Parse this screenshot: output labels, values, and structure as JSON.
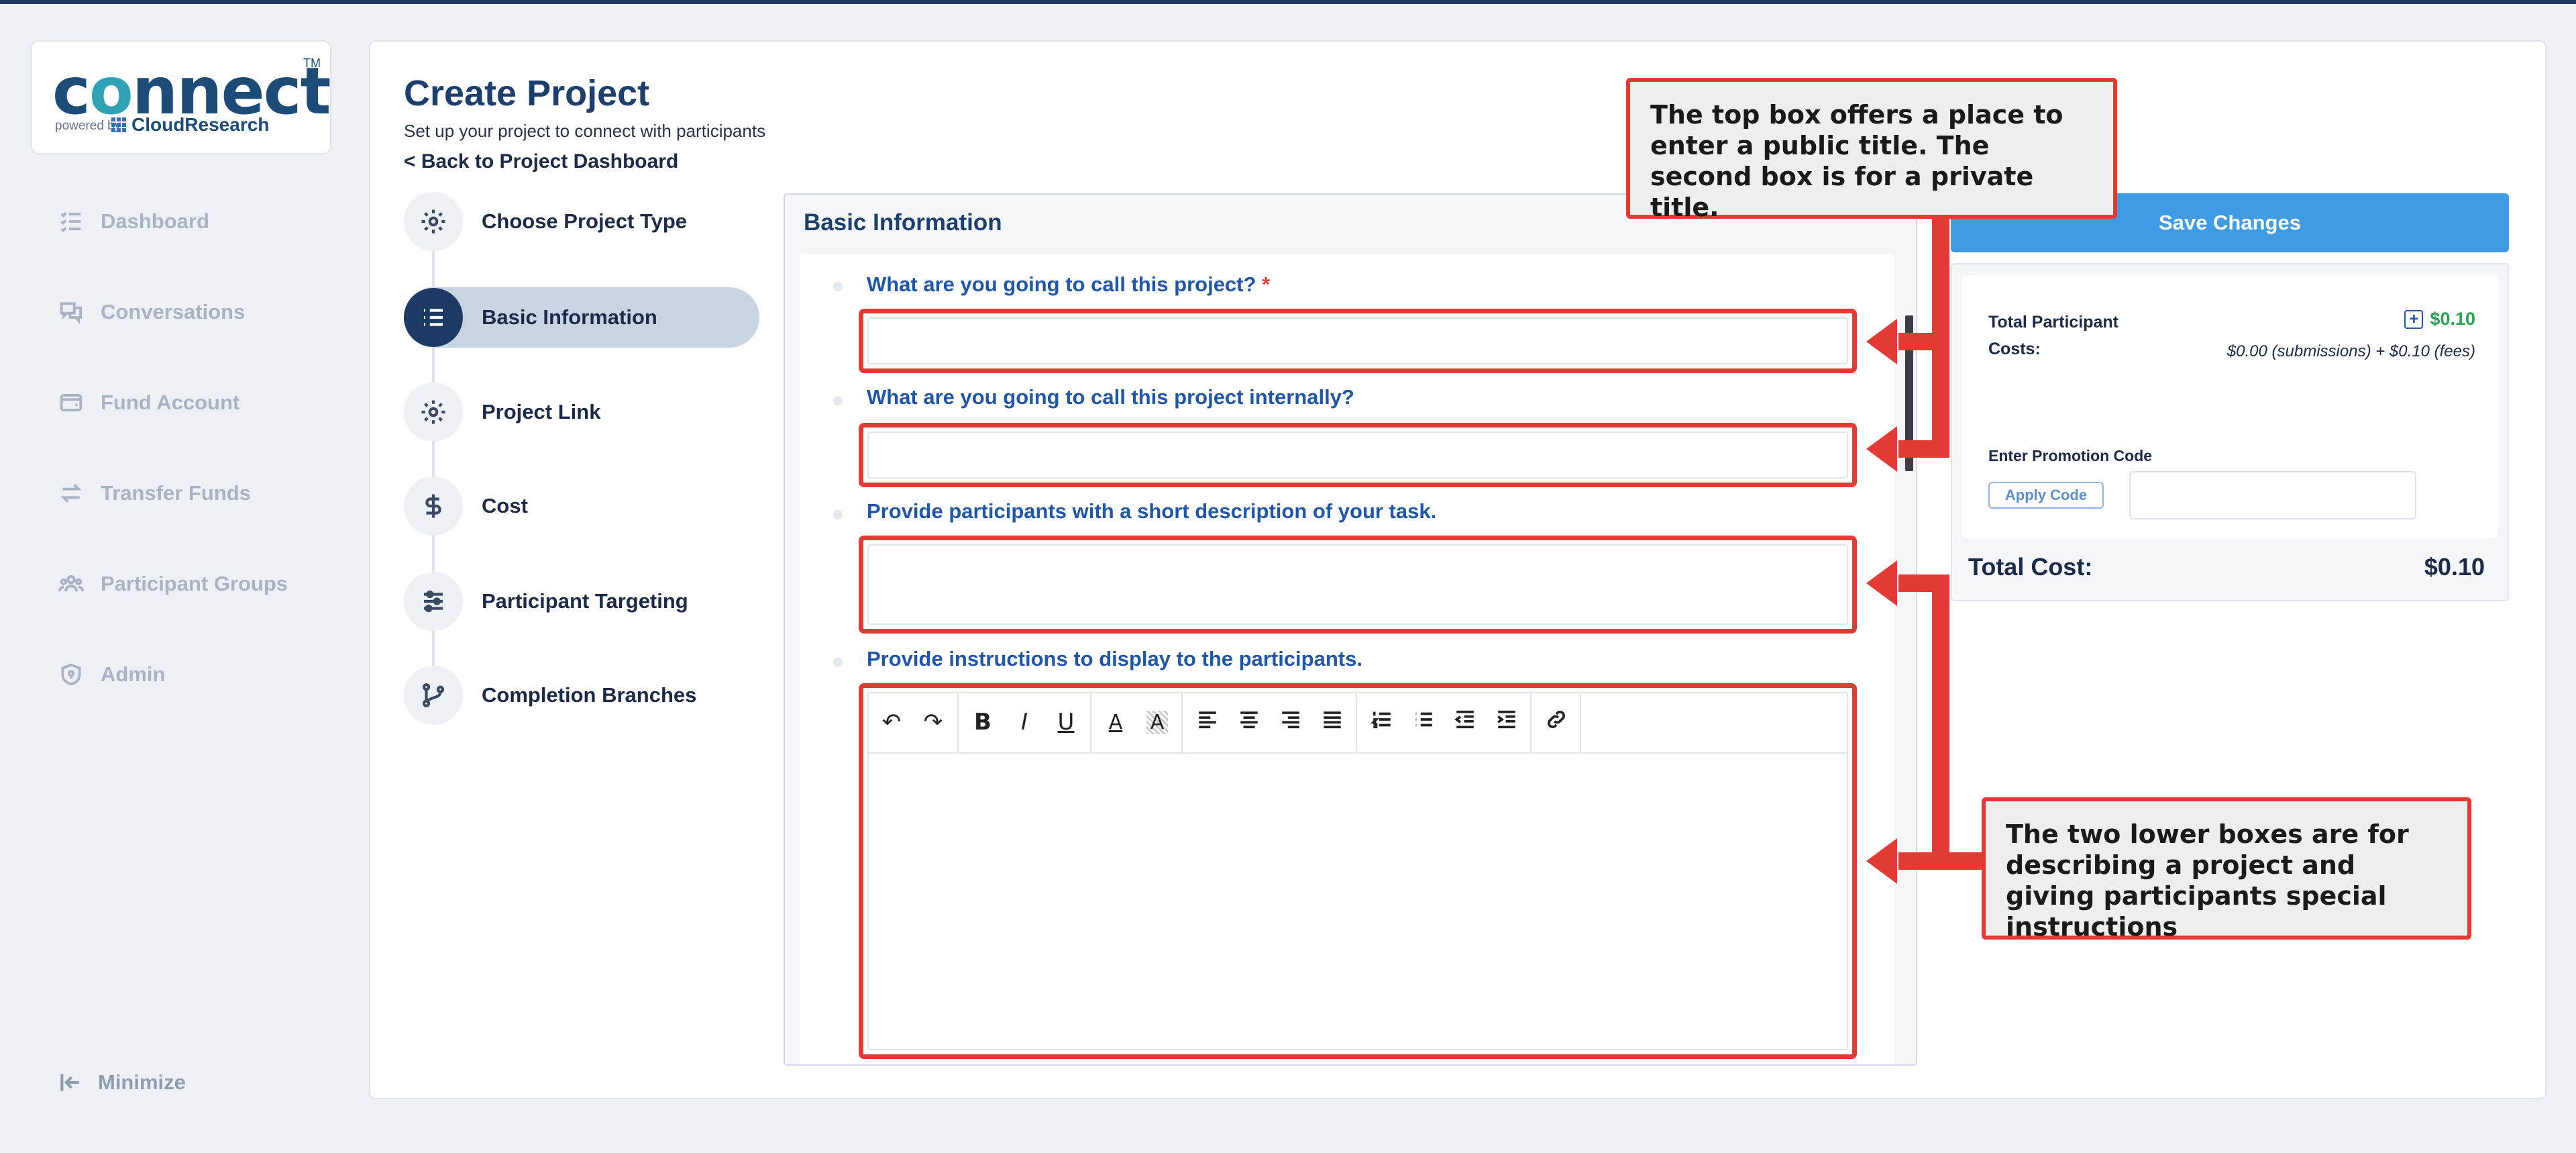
{
  "app": {
    "logo_text": "connect",
    "logo_tm": "TM",
    "logo_powered_by": "powered by",
    "logo_brand": "CloudResearch"
  },
  "sidebar": {
    "items": [
      {
        "label": "Dashboard",
        "icon": "checklist-icon"
      },
      {
        "label": "Conversations",
        "icon": "chat-icon"
      },
      {
        "label": "Fund Account",
        "icon": "wallet-icon"
      },
      {
        "label": "Transfer Funds",
        "icon": "transfer-icon"
      },
      {
        "label": "Participant Groups",
        "icon": "users-icon"
      },
      {
        "label": "Admin",
        "icon": "shield-icon"
      }
    ],
    "minimize_label": "Minimize"
  },
  "header": {
    "title": "Create Project",
    "subtitle": "Set up your project to connect with participants",
    "back_link": "<  Back to Project Dashboard"
  },
  "steps": [
    {
      "label": "Choose Project Type",
      "icon": "gear-icon"
    },
    {
      "label": "Basic Information",
      "icon": "list-icon",
      "active": true
    },
    {
      "label": "Project Link",
      "icon": "gear-icon"
    },
    {
      "label": "Cost",
      "icon": "dollar-icon"
    },
    {
      "label": "Participant Targeting",
      "icon": "sliders-icon"
    },
    {
      "label": "Completion Branches",
      "icon": "branch-icon"
    }
  ],
  "form": {
    "heading": "Basic Information",
    "q1_label": "What are you going to call this project?",
    "q1_required": "*",
    "q1_value": "",
    "q2_label": "What are you going to call this project internally?",
    "q2_value": "",
    "q3_label": "Provide participants with a short description of your task.",
    "q3_value": "",
    "q4_label": "Provide instructions to display to the participants.",
    "q4_value": "",
    "toolbar": {
      "undo": "↶",
      "redo": "↷",
      "bold": "B",
      "italic": "I",
      "underline": "U",
      "font_color": "A",
      "highlight": "A"
    }
  },
  "cost": {
    "save_label": "Save Changes",
    "tpc_label": "Total Participant Costs:",
    "tpc_value": "$0.10",
    "tpc_plus": "+",
    "tpc_breakdown": "$0.00 (submissions) + $0.10 (fees)",
    "promo_label": "Enter Promotion Code",
    "apply_label": "Apply Code",
    "promo_value": "",
    "total_label": "Total Cost:",
    "total_value": "$0.10"
  },
  "annotations": {
    "top": "The top box offers a place to enter a public title. The second box is for a private title.",
    "bottom": "The two lower boxes are for describing a project and giving participants special instructions",
    "color": "#e23b36"
  },
  "colors": {
    "accent": "#3e9be4",
    "brand": "#1c3f6e",
    "question": "#1f56a8",
    "success": "#2aa252"
  }
}
